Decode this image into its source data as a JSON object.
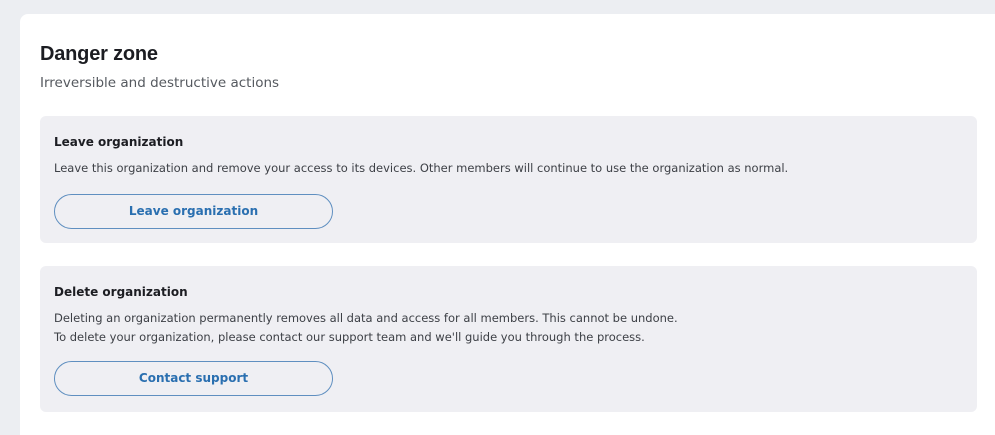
{
  "section": {
    "title": "Danger zone",
    "subtitle": "Irreversible and destructive actions"
  },
  "leave": {
    "title": "Leave organization",
    "description": "Leave this organization and remove your access to its devices. Other members will continue to use the organization as normal.",
    "button_label": "Leave organization"
  },
  "delete": {
    "title": "Delete organization",
    "description_line1": "Deleting an organization permanently removes all data and access for all members. This cannot be undone.",
    "description_line2": "To delete your organization, please contact our support team and we'll guide you through the process.",
    "button_label": "Contact support"
  },
  "colors": {
    "accent": "#2a6fb0",
    "card_background": "#efeff3",
    "page_background": "#eceef2"
  }
}
